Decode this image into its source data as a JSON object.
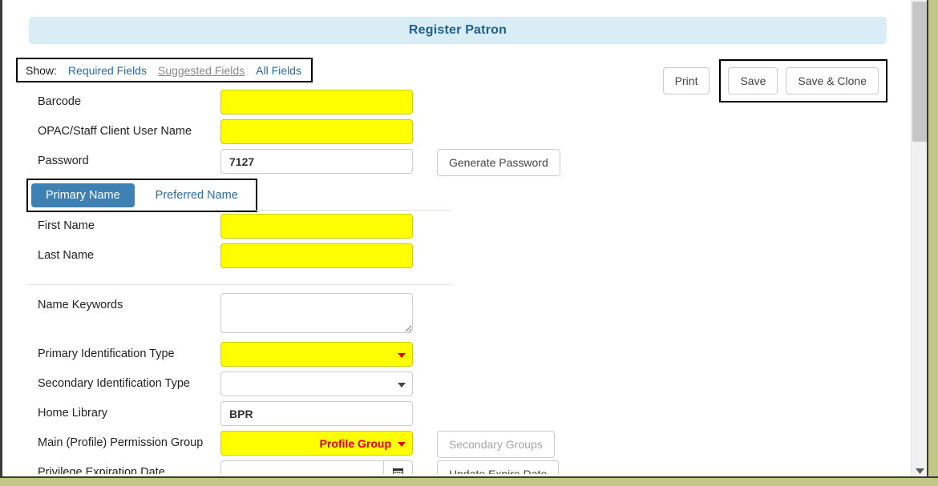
{
  "page": {
    "title": "Register Patron"
  },
  "show_bar": {
    "label": "Show:",
    "links": [
      {
        "label": "Required Fields",
        "state": "link"
      },
      {
        "label": "Suggested Fields",
        "state": "current"
      },
      {
        "label": "All Fields",
        "state": "link"
      }
    ]
  },
  "top_actions": {
    "print": "Print",
    "save": "Save",
    "save_and_clone": "Save & Clone"
  },
  "name_tabs": {
    "primary": "Primary Name",
    "preferred": "Preferred Name"
  },
  "fields": {
    "barcode": {
      "label": "Barcode",
      "value": "",
      "required": true
    },
    "username": {
      "label": "OPAC/Staff Client User Name",
      "value": "",
      "required": true
    },
    "password": {
      "label": "Password",
      "value": "7127",
      "required": false
    },
    "generate_password": "Generate Password",
    "first_name": {
      "label": "First Name",
      "value": "",
      "required": true
    },
    "last_name": {
      "label": "Last Name",
      "value": "",
      "required": true
    },
    "name_keywords": {
      "label": "Name Keywords",
      "value": "",
      "required": false
    },
    "primary_id_type": {
      "label": "Primary Identification Type",
      "value": "",
      "required": true
    },
    "secondary_id_type": {
      "label": "Secondary Identification Type",
      "value": "",
      "required": false
    },
    "home_library": {
      "label": "Home Library",
      "value": "BPR",
      "required": false
    },
    "permission_group": {
      "label": "Main (Profile) Permission Group",
      "value": "Profile Group",
      "required": true
    },
    "secondary_groups_button": "Secondary Groups",
    "expiration_date": {
      "label": "Privilege Expiration Date",
      "value": "",
      "required": false
    },
    "update_expire_button": "Update Expire Date"
  },
  "icons": {
    "calendar": "calendar-icon",
    "scroll_down": "chevron-down-icon",
    "caret": "caret-down-icon"
  },
  "colors": {
    "required_highlight": "#ffff00",
    "banner_bg": "#d9edf7",
    "banner_text": "#1f5d8b",
    "link": "#2b6ca3",
    "tab_active": "#3c80b4",
    "alert_red": "#e00000",
    "annotation": "#000000",
    "frame": "#c3c88a"
  }
}
